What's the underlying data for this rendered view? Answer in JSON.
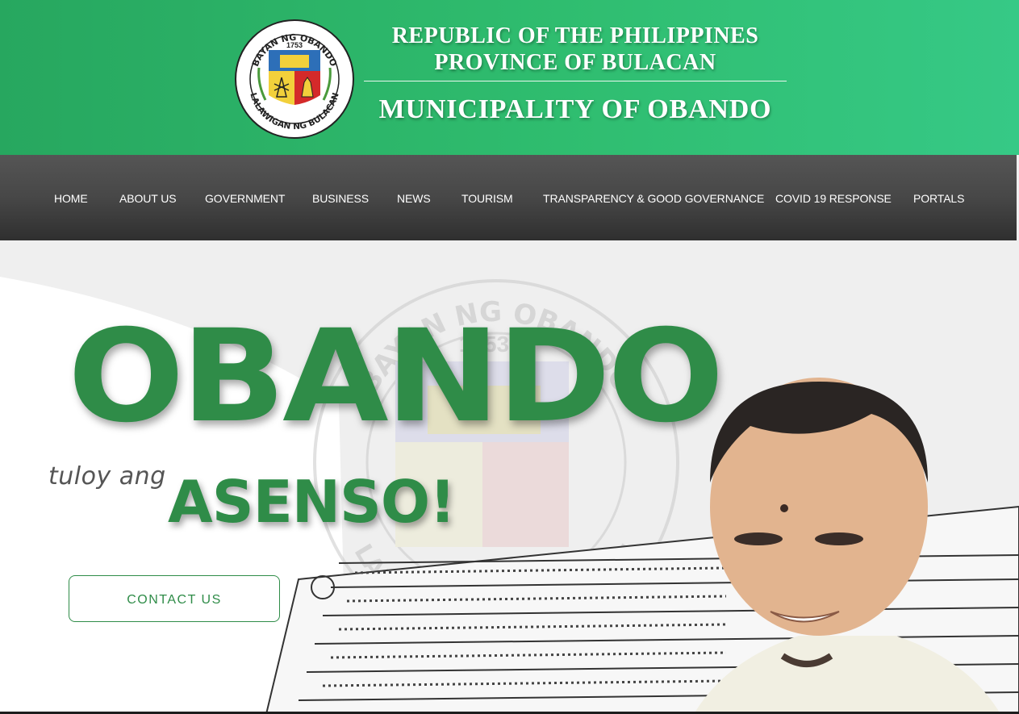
{
  "header": {
    "seal_top_text": "BAYAN NG OBANDO",
    "seal_year": "1753",
    "seal_bottom_text": "LALAWIGAN NG BULACAN",
    "line1": "REPUBLIC OF THE PHILIPPINES",
    "line2": "PROVINCE OF BULACAN",
    "line3": "MUNICIPALITY OF OBANDO"
  },
  "nav": {
    "items": [
      {
        "label": "HOME"
      },
      {
        "label": "ABOUT US"
      },
      {
        "label": "GOVERNMENT"
      },
      {
        "label": "BUSINESS"
      },
      {
        "label": "NEWS"
      },
      {
        "label": "TOURISM"
      },
      {
        "label": "TRANSPARENCY & GOOD GOVERNANCE"
      },
      {
        "label": "COVID 19 RESPONSE"
      },
      {
        "label": "PORTALS"
      }
    ]
  },
  "hero": {
    "headline": "OBANDO",
    "tagline_prefix": "tuloy ang",
    "tagline_main": "ASENSO!",
    "contact_button": "CONTACT US",
    "watermark_top": "BAYAN NG OBANDO",
    "watermark_year": "1753",
    "watermark_bottom": "LALAWIGAN NG BULACAN"
  },
  "colors": {
    "header_green": "#2fbd6f",
    "brand_green": "#2f8c48",
    "nav_dark": "#474747",
    "seal_red": "#d42a2a",
    "seal_yellow": "#f2d03b"
  }
}
